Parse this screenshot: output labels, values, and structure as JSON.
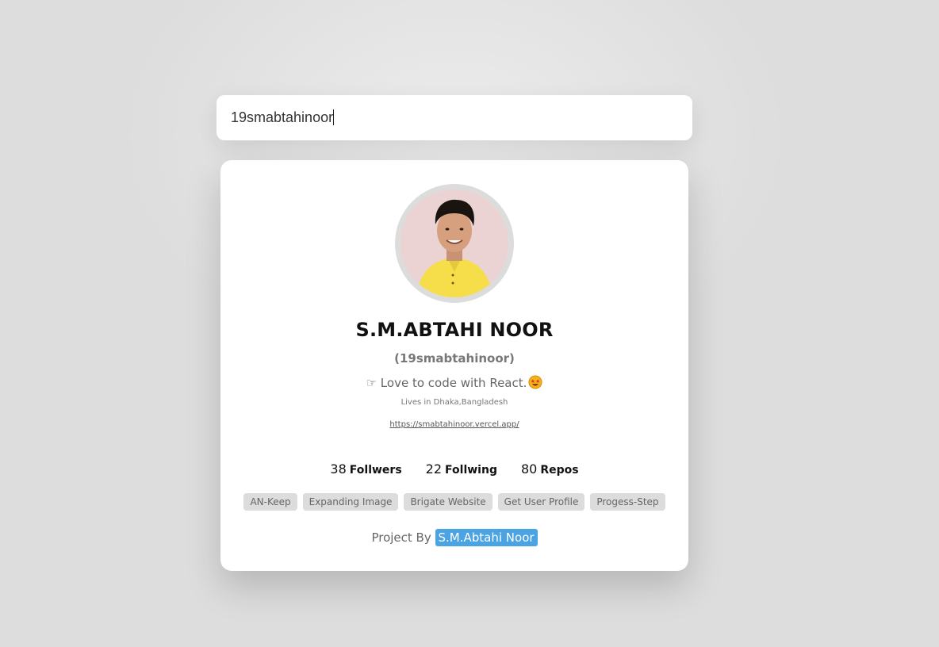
{
  "search": {
    "value": "19smabtahinoor"
  },
  "profile": {
    "avatar_icon": "user-photo",
    "name": "S.M.ABTAHI NOOR",
    "login": "(19smabtahinoor)",
    "bio": "☞ Love to code with React.",
    "bio_emoji": "star-struck-emoji",
    "location": "Lives in Dhaka,Bangladesh",
    "blog": "https://smabtahinoor.vercel.app/"
  },
  "stats": [
    {
      "value": "38",
      "label": "Follwers"
    },
    {
      "value": "22",
      "label": "Follwing"
    },
    {
      "value": "80",
      "label": "Repos"
    }
  ],
  "repos": [
    "AN-Keep",
    "Expanding Image",
    "Brigate Website",
    "Get User Profile",
    "Progess-Step"
  ],
  "footer": {
    "prefix": "Project By",
    "author": "S.M.Abtahi Noor"
  },
  "colors": {
    "background": "#dddddd",
    "card": "#ffffff",
    "repo_tag": "#dcdcdc",
    "author_badge": "#4aa3e2"
  }
}
